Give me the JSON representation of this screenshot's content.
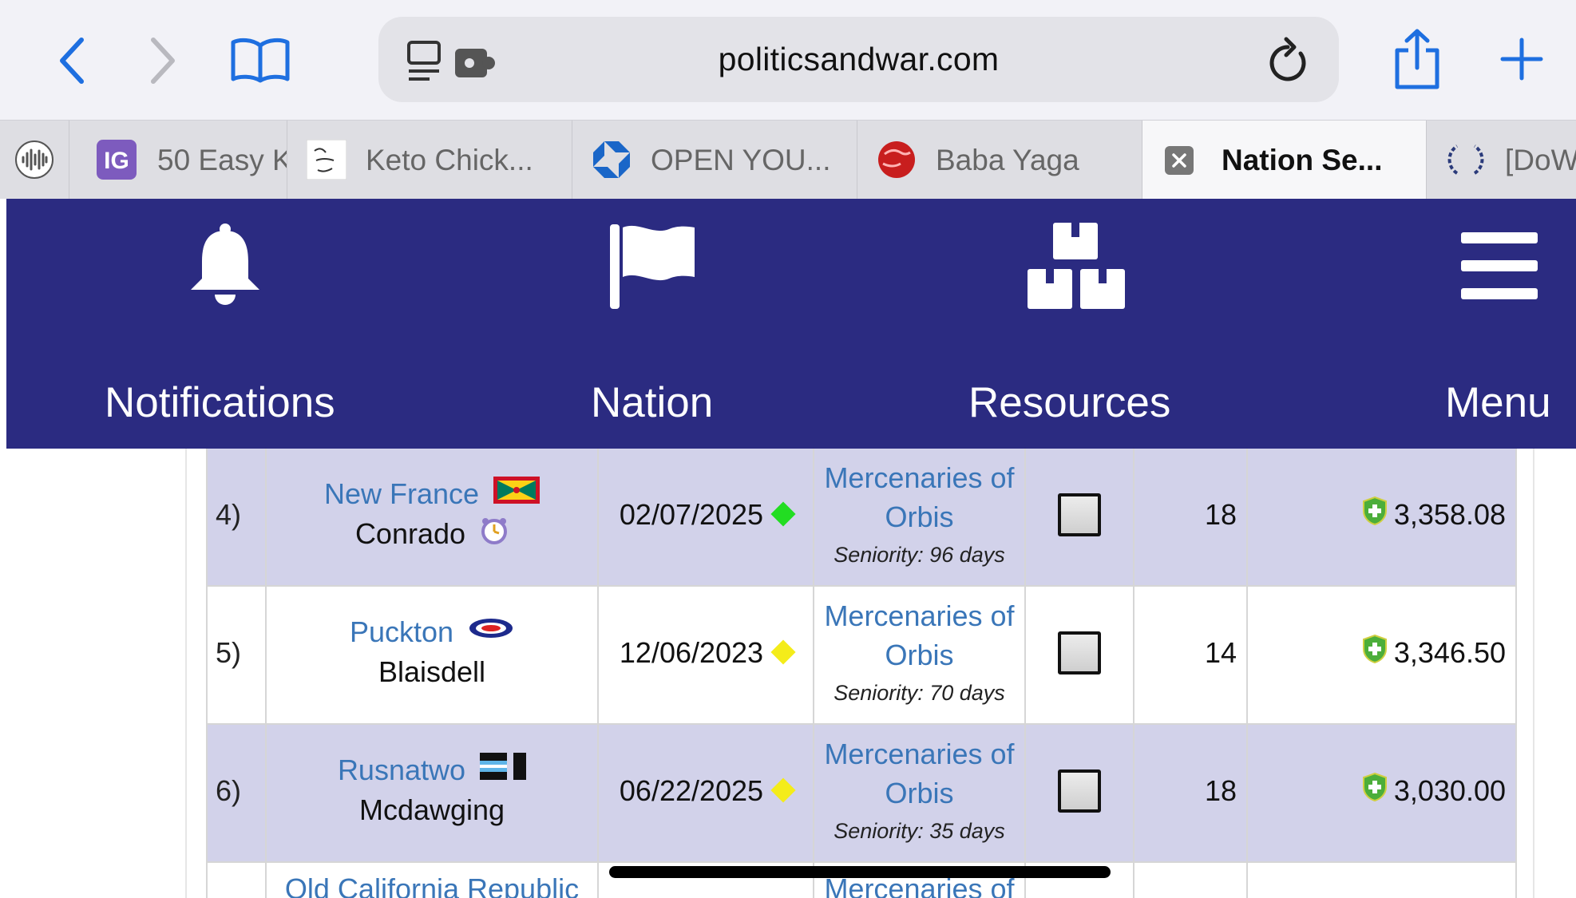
{
  "browser": {
    "url": "politicsandwar.com",
    "icons": [
      "back-chevron-icon",
      "forward-chevron-icon",
      "bookmarks-book-icon",
      "reader-icon",
      "extension-icon",
      "reload-icon",
      "share-icon",
      "new-tab-plus-icon"
    ]
  },
  "tabs": [
    {
      "title": "",
      "favicon": "waveform-icon"
    },
    {
      "title": "50 Easy K",
      "favicon": "ig-logo-icon"
    },
    {
      "title": "Keto Chick...",
      "favicon": "joy-filled-eats-icon"
    },
    {
      "title": "OPEN YOU...",
      "favicon": "chase-logo-icon"
    },
    {
      "title": "Baba Yaga",
      "favicon": "red-globe-icon"
    },
    {
      "title": "Nation Se...",
      "favicon": "close-x-icon",
      "active": true
    },
    {
      "title": "[DoW",
      "favicon": "laurel-wreath-icon"
    }
  ],
  "nav": {
    "items": [
      {
        "label": "Notifications",
        "icon": "bell-icon"
      },
      {
        "label": "Nation",
        "icon": "flag-icon"
      },
      {
        "label": "Resources",
        "icon": "boxes-icon"
      },
      {
        "label": "Menu",
        "icon": "hamburger-menu-icon"
      }
    ],
    "background": "#2b2b81"
  },
  "table": {
    "rows": [
      {
        "rank": "4)",
        "nation": "New France",
        "leader": "Conrado",
        "date": "02/07/2025",
        "activity_color": "#22dd22",
        "alliance": "Mercenaries of Orbis",
        "seniority": "Seniority: 96 days",
        "cities": "18",
        "score": "3,358.08",
        "shaded": true
      },
      {
        "rank": "5)",
        "nation": "Puckton",
        "leader": "Blaisdell",
        "date": "12/06/2023",
        "activity_color": "#f4ec1a",
        "alliance": "Mercenaries of Orbis",
        "seniority": "Seniority: 70 days",
        "cities": "14",
        "score": "3,346.50",
        "shaded": false
      },
      {
        "rank": "6)",
        "nation": "Rusnatwo",
        "leader": "Mcdawging",
        "date": "06/22/2025",
        "activity_color": "#f4ec1a",
        "alliance": "Mercenaries of Orbis",
        "seniority": "Seniority: 35 days",
        "cities": "18",
        "score": "3,030.00",
        "shaded": true
      },
      {
        "rank": "",
        "nation": "Old California Republic",
        "leader": "",
        "date": "",
        "activity_color": "",
        "alliance": "Mercenaries of",
        "seniority": "",
        "cities": "",
        "score": "",
        "shaded": false
      }
    ],
    "link_color": "#3a76b8",
    "shade_color": "#d2d2ea"
  }
}
